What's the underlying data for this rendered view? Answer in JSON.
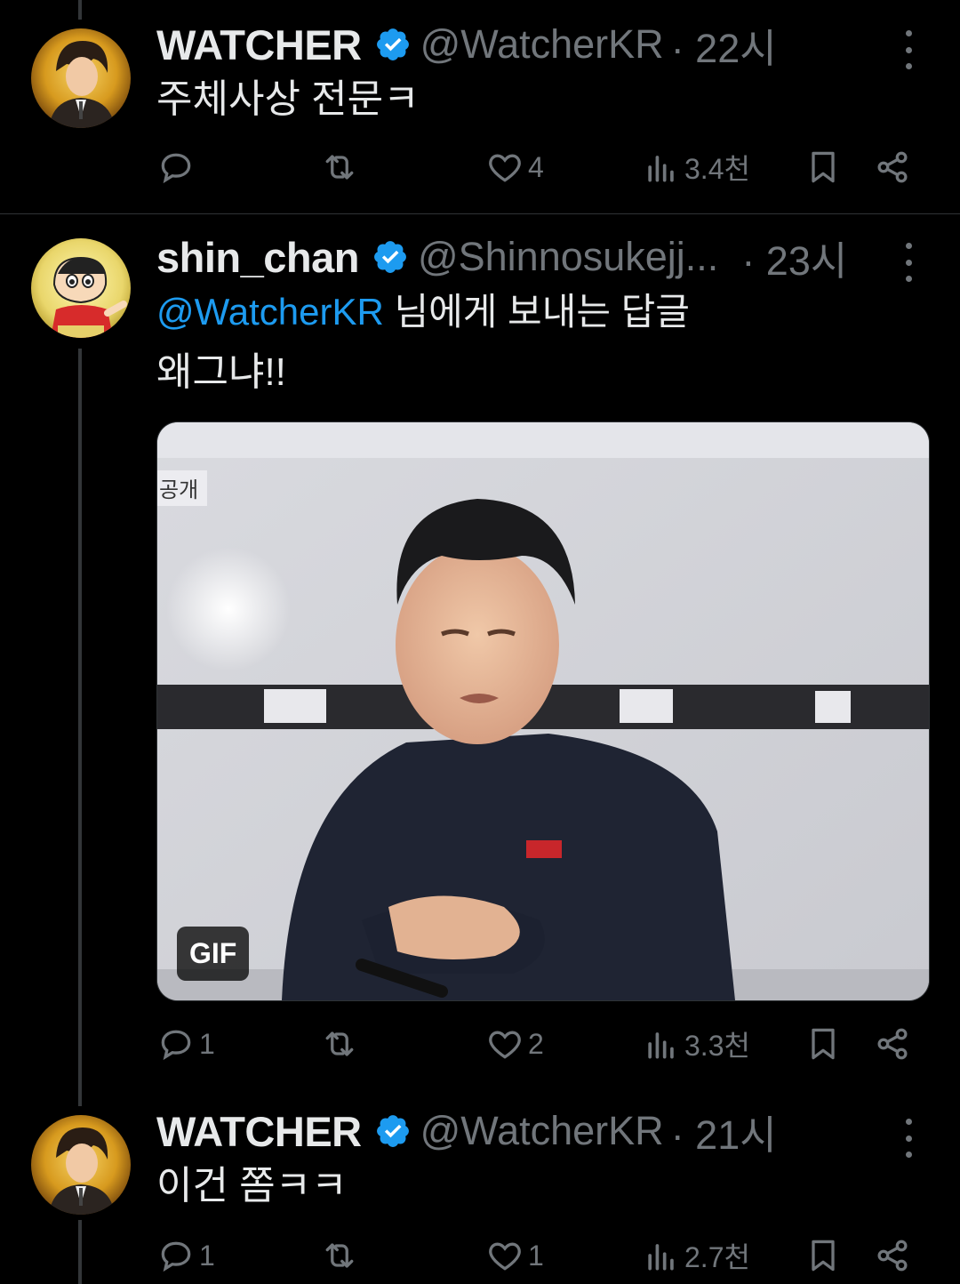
{
  "posts": [
    {
      "name": "WATCHER",
      "handle": "@WatcherKR",
      "time": "· 22시",
      "text": "주체사상 전문ㅋ",
      "reply_count": "",
      "like_count": "4",
      "view_count": "3.4천"
    },
    {
      "name": "shin_chan",
      "handle": "@Shinnosukejj...",
      "time": "· 23시",
      "reply_prefix": "@WatcherKR",
      "reply_suffix": " 님에게 보내는 답글",
      "text": "왜그냐!!",
      "media_label": "공개",
      "media_badge": "GIF",
      "reply_count": "1",
      "like_count": "2",
      "view_count": "3.3천"
    },
    {
      "name": "WATCHER",
      "handle": "@WatcherKR",
      "time": "· 21시",
      "text": "이건 쫌ㅋㅋ",
      "reply_count": "1",
      "like_count": "1",
      "view_count": "2.7천"
    }
  ],
  "colors": {
    "background": "#000000",
    "text": "#e7e9ea",
    "muted": "#71767b",
    "accent": "#1d9bf0"
  },
  "icons": [
    "reply-icon",
    "retweet-icon",
    "like-icon",
    "views-icon",
    "bookmark-icon",
    "share-icon",
    "verified-badge-icon",
    "more-icon"
  ]
}
